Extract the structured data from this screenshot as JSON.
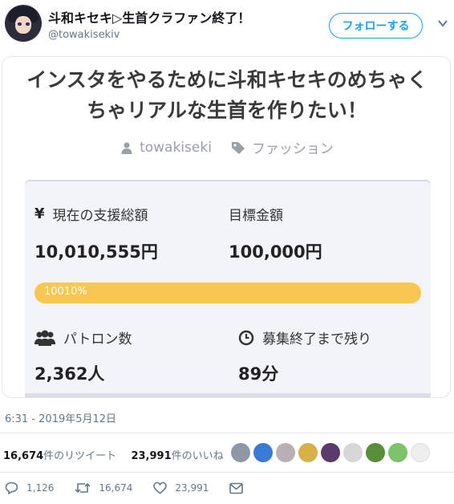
{
  "tweet": {
    "display_name": "斗和キセキ▷生首クラファン終了！",
    "handle": "@towakisekiv",
    "follow_label": "フォローする",
    "timestamp": "6:31 - 2019年5月12日"
  },
  "card": {
    "title_line1": "インスタをやるために斗和キセキのめちゃく",
    "title_line2": "ちゃリアルな生首を作りたい！",
    "author": "towakiseki",
    "category": "ファッション",
    "current_label": "現在の支援総額",
    "current_value": "10,010,555円",
    "goal_label": "目標金額",
    "goal_value": "100,000円",
    "progress_text": "10010%",
    "progress_fraction": 1.0,
    "patrons_label": "パトロン数",
    "patrons_value": "2,362人",
    "remaining_label": "募集終了まで残り",
    "remaining_value": "89分"
  },
  "stats": {
    "retweets_count": "16,674",
    "retweets_label": "件のリツイート",
    "likes_count": "23,991",
    "likes_label": "件のいいね"
  },
  "actions": {
    "reply_count": "1,126",
    "retweet_count": "16,674",
    "like_count": "23,991"
  },
  "colors": {
    "accent": "#1da1f2",
    "progress": "#f7c74f",
    "panel": "#f3f4fa"
  },
  "icons": [
    "yen-icon",
    "user-icon",
    "tag-icon",
    "people-icon",
    "clock-icon",
    "reply-icon",
    "retweet-icon",
    "heart-icon",
    "dm-icon",
    "chevron-down-icon"
  ]
}
